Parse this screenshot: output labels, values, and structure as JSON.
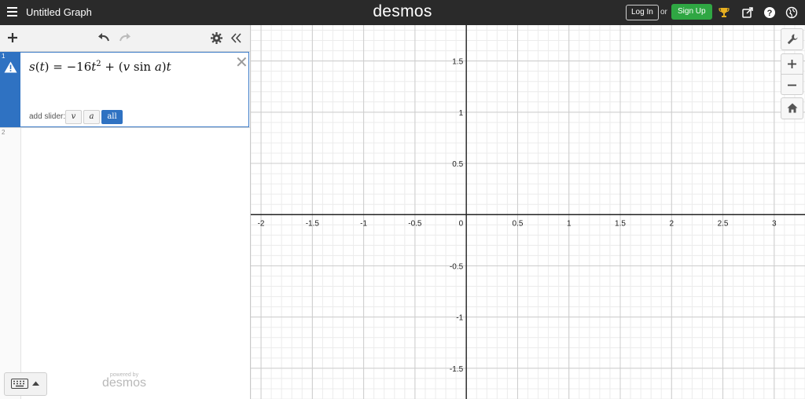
{
  "topbar": {
    "graph_title": "Untitled Graph",
    "brand": "desmos",
    "login_label": "Log In",
    "or_label": "or",
    "signup_label": "Sign Up",
    "icons": [
      "menu-icon",
      "trophy-icon",
      "share-icon",
      "help-icon",
      "globe-icon"
    ],
    "colors": {
      "bar": "#2a2a2a",
      "signup": "#2fa743"
    }
  },
  "panel": {
    "toolbar_icons": [
      "plus-icon",
      "undo-icon",
      "redo-icon",
      "gear-icon",
      "collapse-icon"
    ],
    "expressions": [
      {
        "number": "1",
        "status": "warning",
        "formula": {
          "lhs": "s",
          "lhs_var": "t",
          "equals": "=",
          "coef": "−16",
          "var_t": "t",
          "exponent": "2",
          "plus": "+",
          "v": "v",
          "sin": "sin",
          "a": "a",
          "t": "t"
        },
        "slider_prompt": "add slider:",
        "slider_options": [
          "v",
          "a",
          "all"
        ]
      },
      {
        "number": "2"
      }
    ],
    "powered_by": "powered by",
    "powered_brand": "desmos",
    "colors": {
      "selected": "#2f72c2"
    }
  },
  "graph": {
    "x_ticks": [
      "-2",
      "-1.5",
      "-1",
      "-0.5",
      "0",
      "0.5",
      "1",
      "1.5",
      "2",
      "2.5",
      "3"
    ],
    "y_ticks": [
      "1.5",
      "1",
      "0.5",
      "-0.5",
      "-1",
      "-1.5"
    ],
    "x_range": [
      -2.1,
      3.3
    ],
    "y_range": [
      -1.8,
      1.85
    ],
    "grid": true
  },
  "right_tools": [
    "wrench-icon",
    "zoom-in-icon",
    "zoom-out-icon",
    "home-icon"
  ]
}
